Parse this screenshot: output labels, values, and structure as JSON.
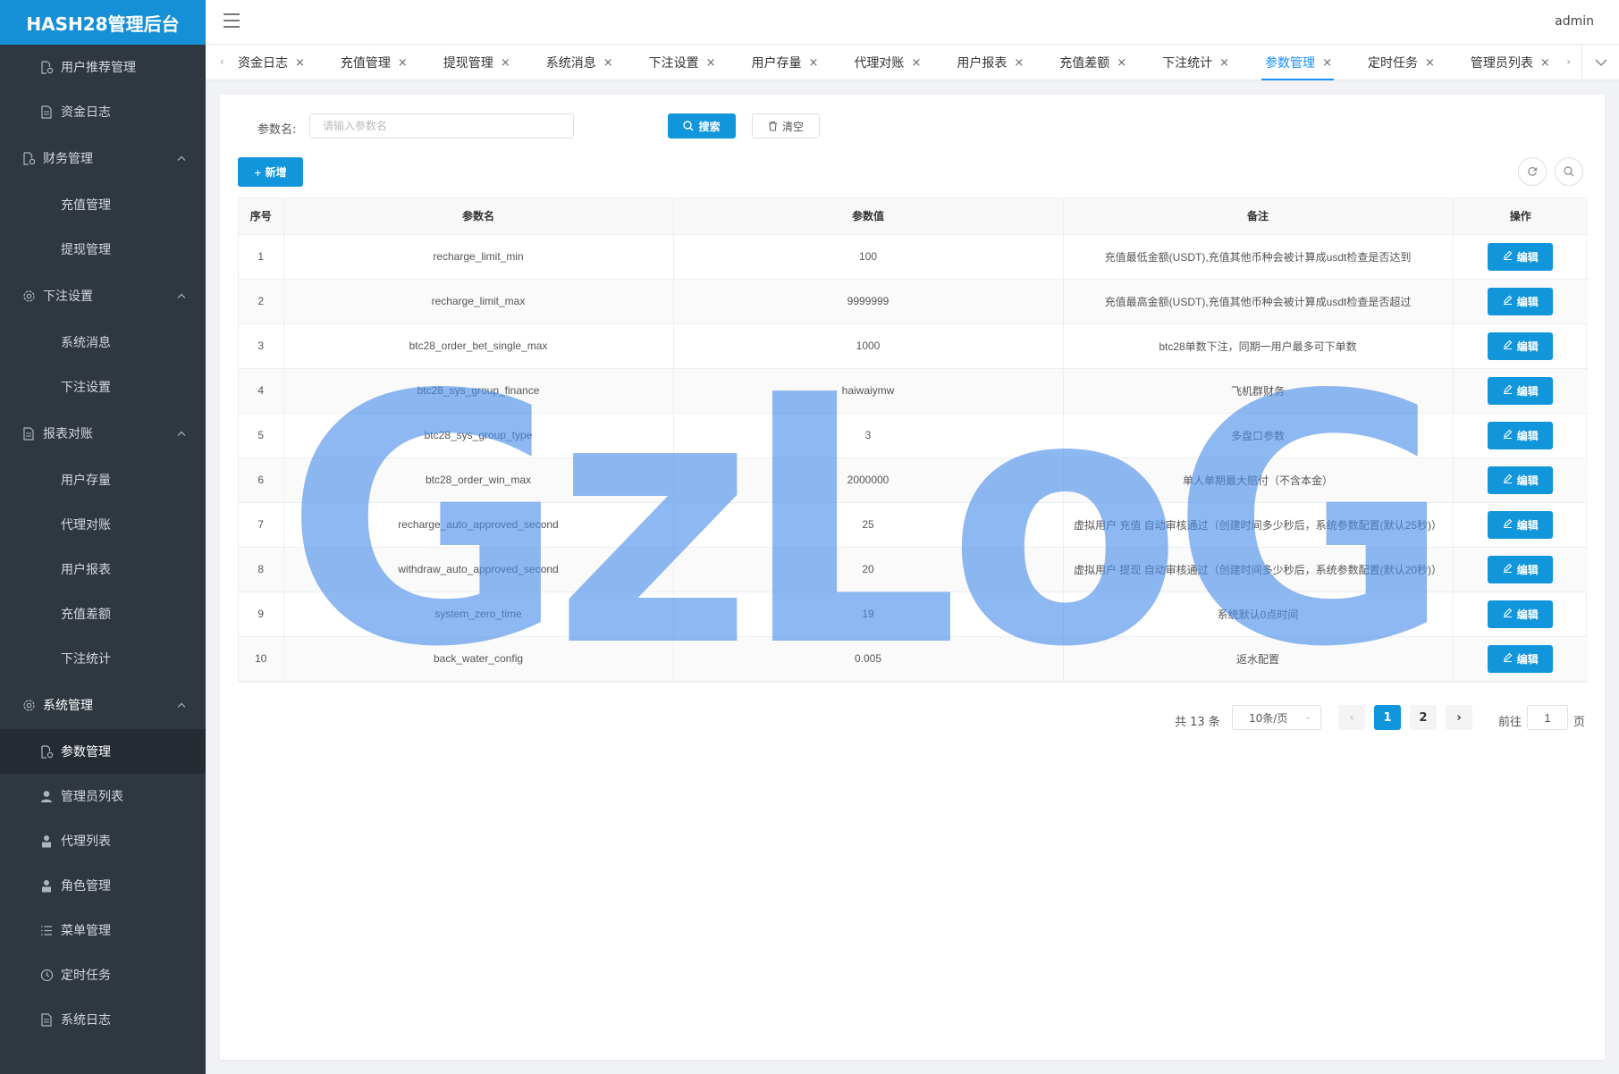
{
  "app": {
    "title": "HASH28管理后台",
    "user": "admin"
  },
  "sidebar": {
    "items": [
      {
        "label": "用户推荐管理",
        "icon": "doc-gear-icon",
        "kind": "iconed"
      },
      {
        "label": "资金日志",
        "icon": "doc-icon",
        "kind": "iconed"
      },
      {
        "label": "财务管理",
        "icon": "doc-gear-icon",
        "kind": "group"
      },
      {
        "label": "充值管理",
        "kind": "sub"
      },
      {
        "label": "提现管理",
        "kind": "sub"
      },
      {
        "label": "下注设置",
        "icon": "gear-icon",
        "kind": "group"
      },
      {
        "label": "系统消息",
        "kind": "sub"
      },
      {
        "label": "下注设置",
        "kind": "sub"
      },
      {
        "label": "报表对账",
        "icon": "doc-icon",
        "kind": "group"
      },
      {
        "label": "用户存量",
        "kind": "sub"
      },
      {
        "label": "代理对账",
        "kind": "sub"
      },
      {
        "label": "用户报表",
        "kind": "sub"
      },
      {
        "label": "充值差额",
        "kind": "sub"
      },
      {
        "label": "下注统计",
        "kind": "sub"
      },
      {
        "label": "系统管理",
        "icon": "gear-icon",
        "kind": "group"
      },
      {
        "label": "参数管理",
        "icon": "doc-gear-icon",
        "kind": "iconed"
      },
      {
        "label": "管理员列表",
        "icon": "user-icon",
        "kind": "iconed"
      },
      {
        "label": "代理列表",
        "icon": "user-lock-icon",
        "kind": "iconed"
      },
      {
        "label": "角色管理",
        "icon": "user-lock-icon",
        "kind": "iconed"
      },
      {
        "label": "菜单管理",
        "icon": "list-icon",
        "kind": "iconed"
      },
      {
        "label": "定时任务",
        "icon": "clock-icon",
        "kind": "iconed"
      },
      {
        "label": "系统日志",
        "icon": "doc-icon",
        "kind": "iconed"
      }
    ],
    "active": "参数管理"
  },
  "tabs": [
    "资金日志",
    "充值管理",
    "提现管理",
    "系统消息",
    "下注设置",
    "用户存量",
    "代理对账",
    "用户报表",
    "充值差额",
    "下注统计",
    "参数管理",
    "定时任务",
    "管理员列表"
  ],
  "active_tab": "参数管理",
  "search": {
    "label": "参数名:",
    "placeholder": "请输入参数名",
    "value": "",
    "search_label": "搜索",
    "clear_label": "清空"
  },
  "toolbar": {
    "add_label": "新增"
  },
  "table": {
    "columns": [
      "序号",
      "参数名",
      "参数值",
      "备注",
      "操作"
    ],
    "edit_label": "编辑",
    "rows": [
      [
        "1",
        "recharge_limit_min",
        "100",
        "充值最低金额(USDT),充值其他币种会被计算成usdt检查是否达到"
      ],
      [
        "2",
        "recharge_limit_max",
        "9999999",
        "充值最高金额(USDT),充值其他币种会被计算成usdt检查是否超过"
      ],
      [
        "3",
        "btc28_order_bet_single_max",
        "1000",
        "btc28单数下注，同期一用户最多可下单数"
      ],
      [
        "4",
        "btc28_sys_group_finance",
        "haiwaiymw",
        "飞机群财务"
      ],
      [
        "5",
        "btc28_sys_group_type",
        "3",
        "多盘口参数"
      ],
      [
        "6",
        "btc28_order_win_max",
        "2000000",
        "单人单期最大赔付（不含本金）"
      ],
      [
        "7",
        "recharge_auto_approved_second",
        "25",
        "虚拟用户 充值 自动审核通过（创建时间多少秒后，系统参数配置(默认25秒)）"
      ],
      [
        "8",
        "withdraw_auto_approved_second",
        "20",
        "虚拟用户 提现 自动审核通过（创建时间多少秒后，系统参数配置(默认20秒)）"
      ],
      [
        "9",
        "system_zero_time",
        "19",
        "系统默认0点时间"
      ],
      [
        "10",
        "back_water_config",
        "0.005",
        "返水配置"
      ]
    ]
  },
  "pagination": {
    "total_text": "共 13 条",
    "page_size": "10条/页",
    "pages": [
      "1",
      "2"
    ],
    "current": "1",
    "goto_label": "前往",
    "goto_value": "1",
    "page_suffix": "页"
  },
  "watermark": "GzLoG"
}
